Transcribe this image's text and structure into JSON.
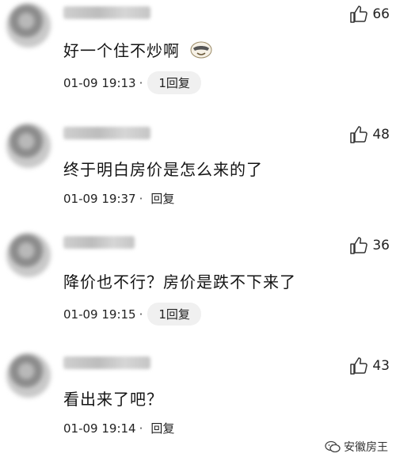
{
  "comments": [
    {
      "text": "好一个住不炒啊",
      "time": "01-09 19:13",
      "sep": "·",
      "reply": "1回复",
      "likes": "66",
      "emoji": "face-with-sunglasses-icon"
    },
    {
      "text": "终于明白房价是怎么来的了",
      "time": "01-09 19:37",
      "sep": "·",
      "reply": "回复",
      "likes": "48"
    },
    {
      "text": "降价也不行？房价是跌不下来了",
      "time": "01-09 19:15",
      "sep": "·",
      "reply": "1回复",
      "likes": "36"
    },
    {
      "text": "看出来了吧？",
      "time": "01-09 19:14",
      "sep": "·",
      "reply": "回复",
      "likes": "43"
    }
  ],
  "watermark": {
    "text": "安徽房王",
    "icon": "wechat-icon"
  }
}
